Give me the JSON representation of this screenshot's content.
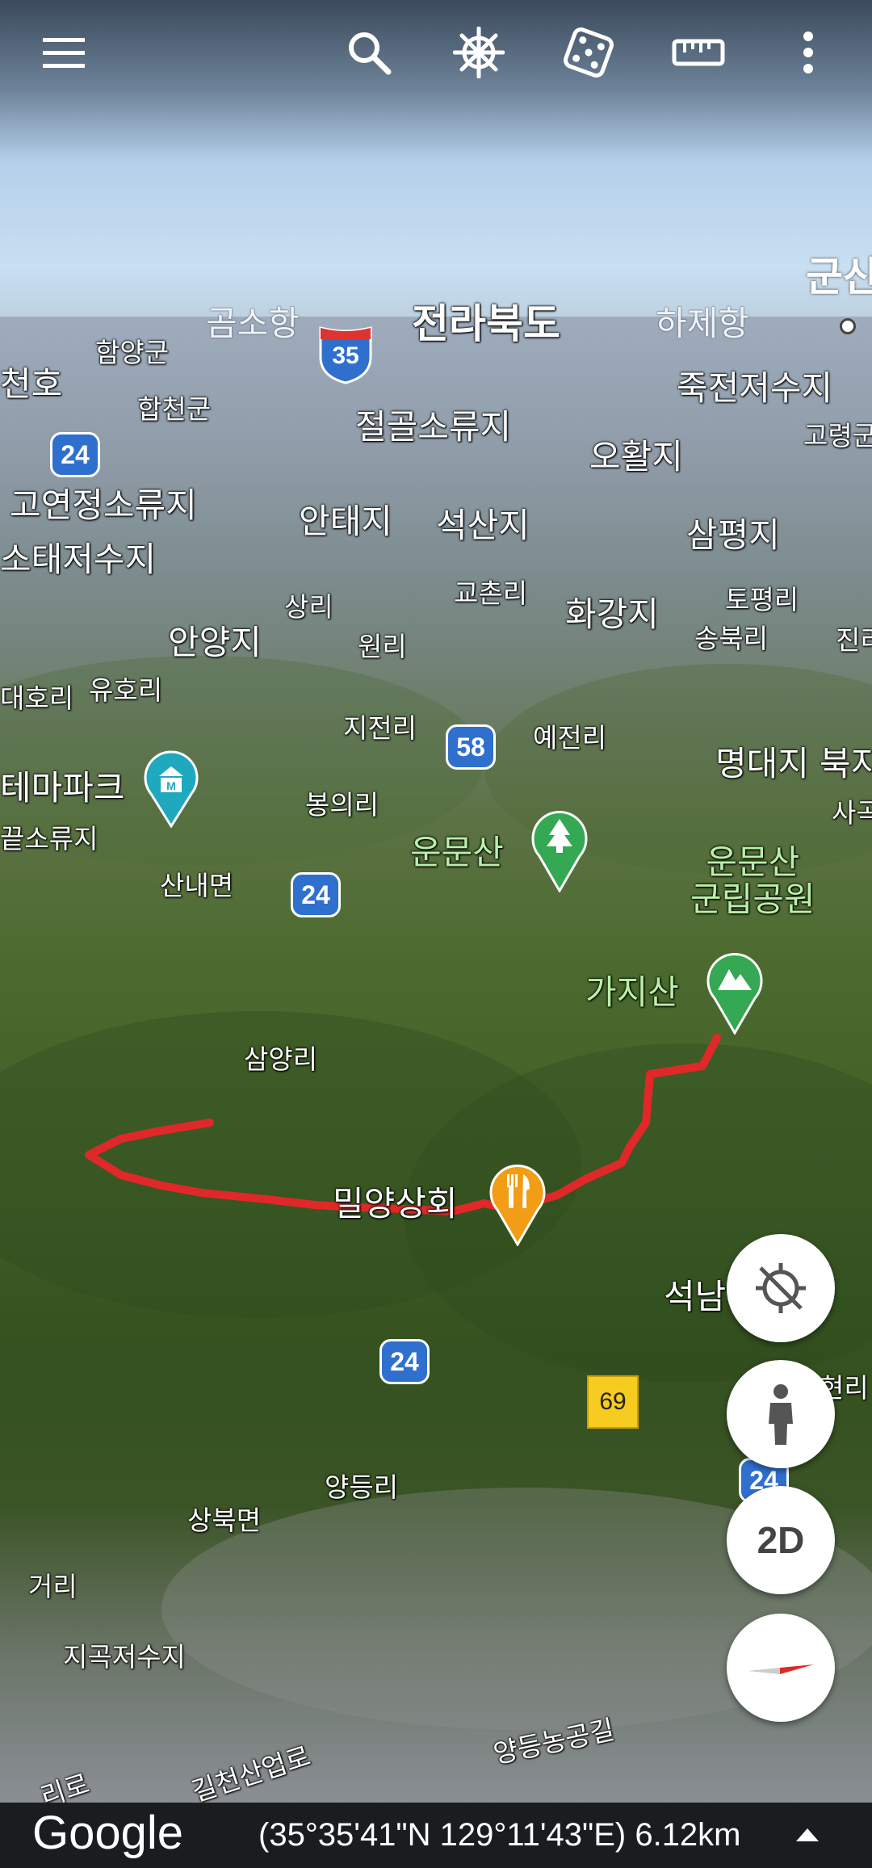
{
  "toolbar": {
    "menu": "menu-icon",
    "search": "search-icon",
    "voyager": "ship-wheel-icon",
    "feeling_lucky": "dice-icon",
    "measure": "ruler-icon",
    "more": "more-vert-icon"
  },
  "map_labels": {
    "gunsan": "군산",
    "gomsohang": "곰소항",
    "jeonbuk": "전라북도",
    "hajehang": "하제항",
    "hamyanggun": "함양군",
    "cheonho": "천호",
    "jukjeon": "죽전저수지",
    "hapcheon": "합천군",
    "jeolgol": "절골소류지",
    "goryeong": "고령군",
    "ohwal": "오활지",
    "goyeon": "고연정소류지",
    "antae": "안태지",
    "seoksan": "석산지",
    "sampyeong": "삼평지",
    "sotae": "소태저수지",
    "gochon": "교촌리",
    "topyeong": "토평리",
    "sangri": "상리",
    "hwagang": "화강지",
    "songbuk": "송북리",
    "anyang": "안양지",
    "wonri": "원리",
    "jinri": "진리",
    "daeho": "대호리",
    "yuho": "유호리",
    "jijeon": "지전리",
    "yejeon": "예전리",
    "myeongdae": "명대지",
    "bukji": "북지",
    "themepark": "테마파크",
    "bongui": "봉의리",
    "sagok": "사곡",
    "kkeut": "끝소류지",
    "unmunsan": "운문산",
    "unmun_park": "운문산\n군립공원",
    "sannae": "산내면",
    "gajisan": "가지산",
    "samyang": "삼양리",
    "milyang_store": "밀양상회",
    "seoknam": "석남",
    "hyeonri": "현리",
    "yangdeung": "양등리",
    "sangbuk": "상북면",
    "geori": "거리",
    "jigok": "지곡저수지",
    "yangdeung_road": "양등농공길",
    "gilcheon": "길천산업로",
    "ri_ro": "리로"
  },
  "road_signs": {
    "r35": "35",
    "r24a": "24",
    "r58": "58",
    "r24b": "24",
    "r24c": "24",
    "r69": "69",
    "r24d": "24"
  },
  "controls": {
    "location": "location-disabled-icon",
    "street_view": "pegman-icon",
    "view_mode": "2D",
    "compass": "compass-icon"
  },
  "footer": {
    "brand": "Google",
    "coordinates": "(35°35'41\"N 129°11'43\"E) 6.12km"
  },
  "colors": {
    "route": "#e02828",
    "park_pin": "#34a853",
    "food_pin": "#f29d15",
    "museum_pin": "#1fa9be"
  }
}
